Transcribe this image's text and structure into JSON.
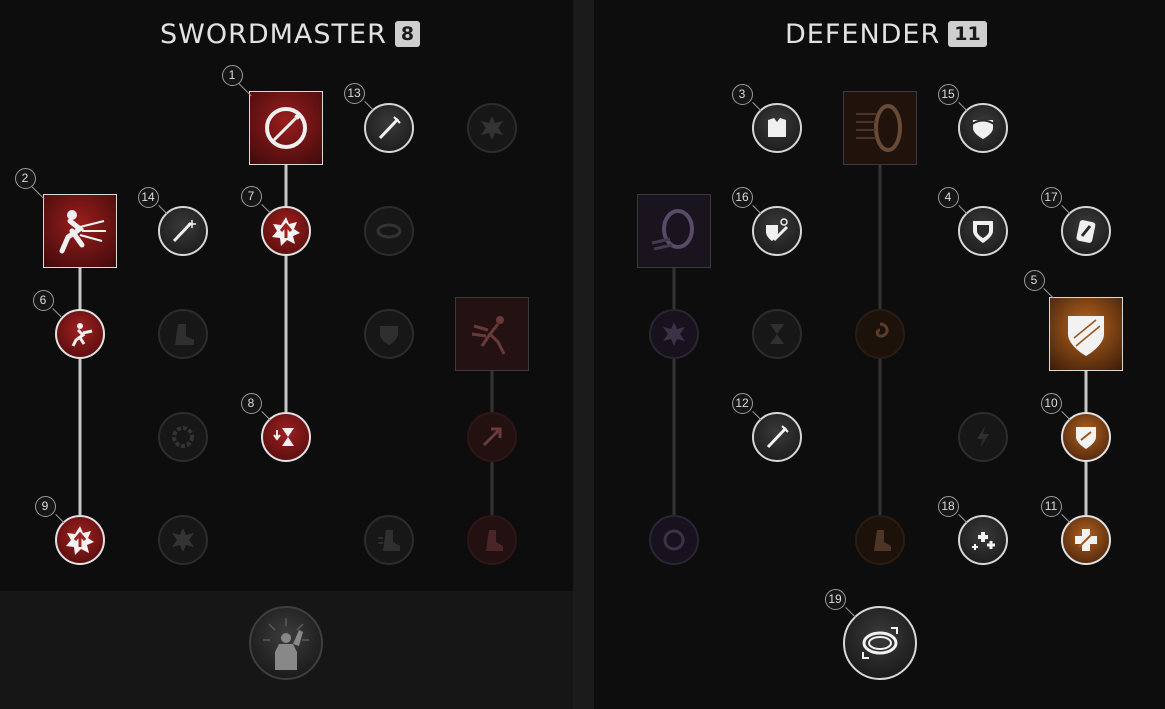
{
  "trees": {
    "swordmaster": {
      "title": "SWORDMASTER",
      "points": "8"
    },
    "defender": {
      "title": "DEFENDER",
      "points": "11"
    }
  },
  "order_badges": [
    "1",
    "2",
    "3",
    "4",
    "5",
    "6",
    "7",
    "8",
    "9",
    "10",
    "11",
    "12",
    "13",
    "14",
    "15",
    "16",
    "17",
    "18",
    "19"
  ],
  "colors": {
    "swordmaster_accent": "#a02020",
    "defender_accent": "#b0601e",
    "active_line": "#c7c7c7"
  },
  "nodes": {
    "swordmaster": [
      {
        "name": "whirling-blade-active-icon",
        "state": "selected",
        "order": "1"
      },
      {
        "name": "leaping-strike-active-icon",
        "state": "selected",
        "order": "2"
      },
      {
        "name": "charging-rush-active-icon",
        "state": "locked"
      },
      {
        "name": "buff-passive-icon",
        "state": "selected",
        "order": "7"
      },
      {
        "name": "cooldown-passive-icon",
        "state": "selected",
        "order": "8"
      },
      {
        "name": "crit-passive-icon",
        "state": "selected",
        "order": "9"
      },
      {
        "name": "sword-passive-icon",
        "state": "selected",
        "order": "14"
      },
      {
        "name": "slash-passive-icon",
        "state": "selected",
        "order": "13"
      },
      {
        "name": "upgrade-passive-icon",
        "state": "selected",
        "order": "6"
      }
    ],
    "defender": [
      {
        "name": "shield-rush-active-icon",
        "state": "selected"
      },
      {
        "name": "shield-bash-active-icon",
        "state": "locked"
      },
      {
        "name": "fortify-active-icon",
        "state": "selected",
        "order": "5"
      },
      {
        "name": "armor-passive-icon",
        "state": "selected",
        "order": "3"
      },
      {
        "name": "frost-shield-passive-icon",
        "state": "selected",
        "order": "16"
      },
      {
        "name": "shield-passive-icon",
        "state": "selected",
        "order": "4"
      },
      {
        "name": "guard-passive-icon",
        "state": "selected",
        "order": "17"
      },
      {
        "name": "deflect-passive-icon",
        "state": "selected",
        "order": "15"
      },
      {
        "name": "sword-strike-passive-icon",
        "state": "selected",
        "order": "12"
      },
      {
        "name": "shield-buff-passive-icon",
        "state": "selected",
        "order": "10"
      },
      {
        "name": "heal-passive-icon",
        "state": "selected",
        "order": "11"
      },
      {
        "name": "health-boost-passive-icon",
        "state": "selected",
        "order": "18"
      },
      {
        "name": "defiant-stance-ultimate-icon",
        "state": "selected",
        "order": "19"
      }
    ]
  }
}
